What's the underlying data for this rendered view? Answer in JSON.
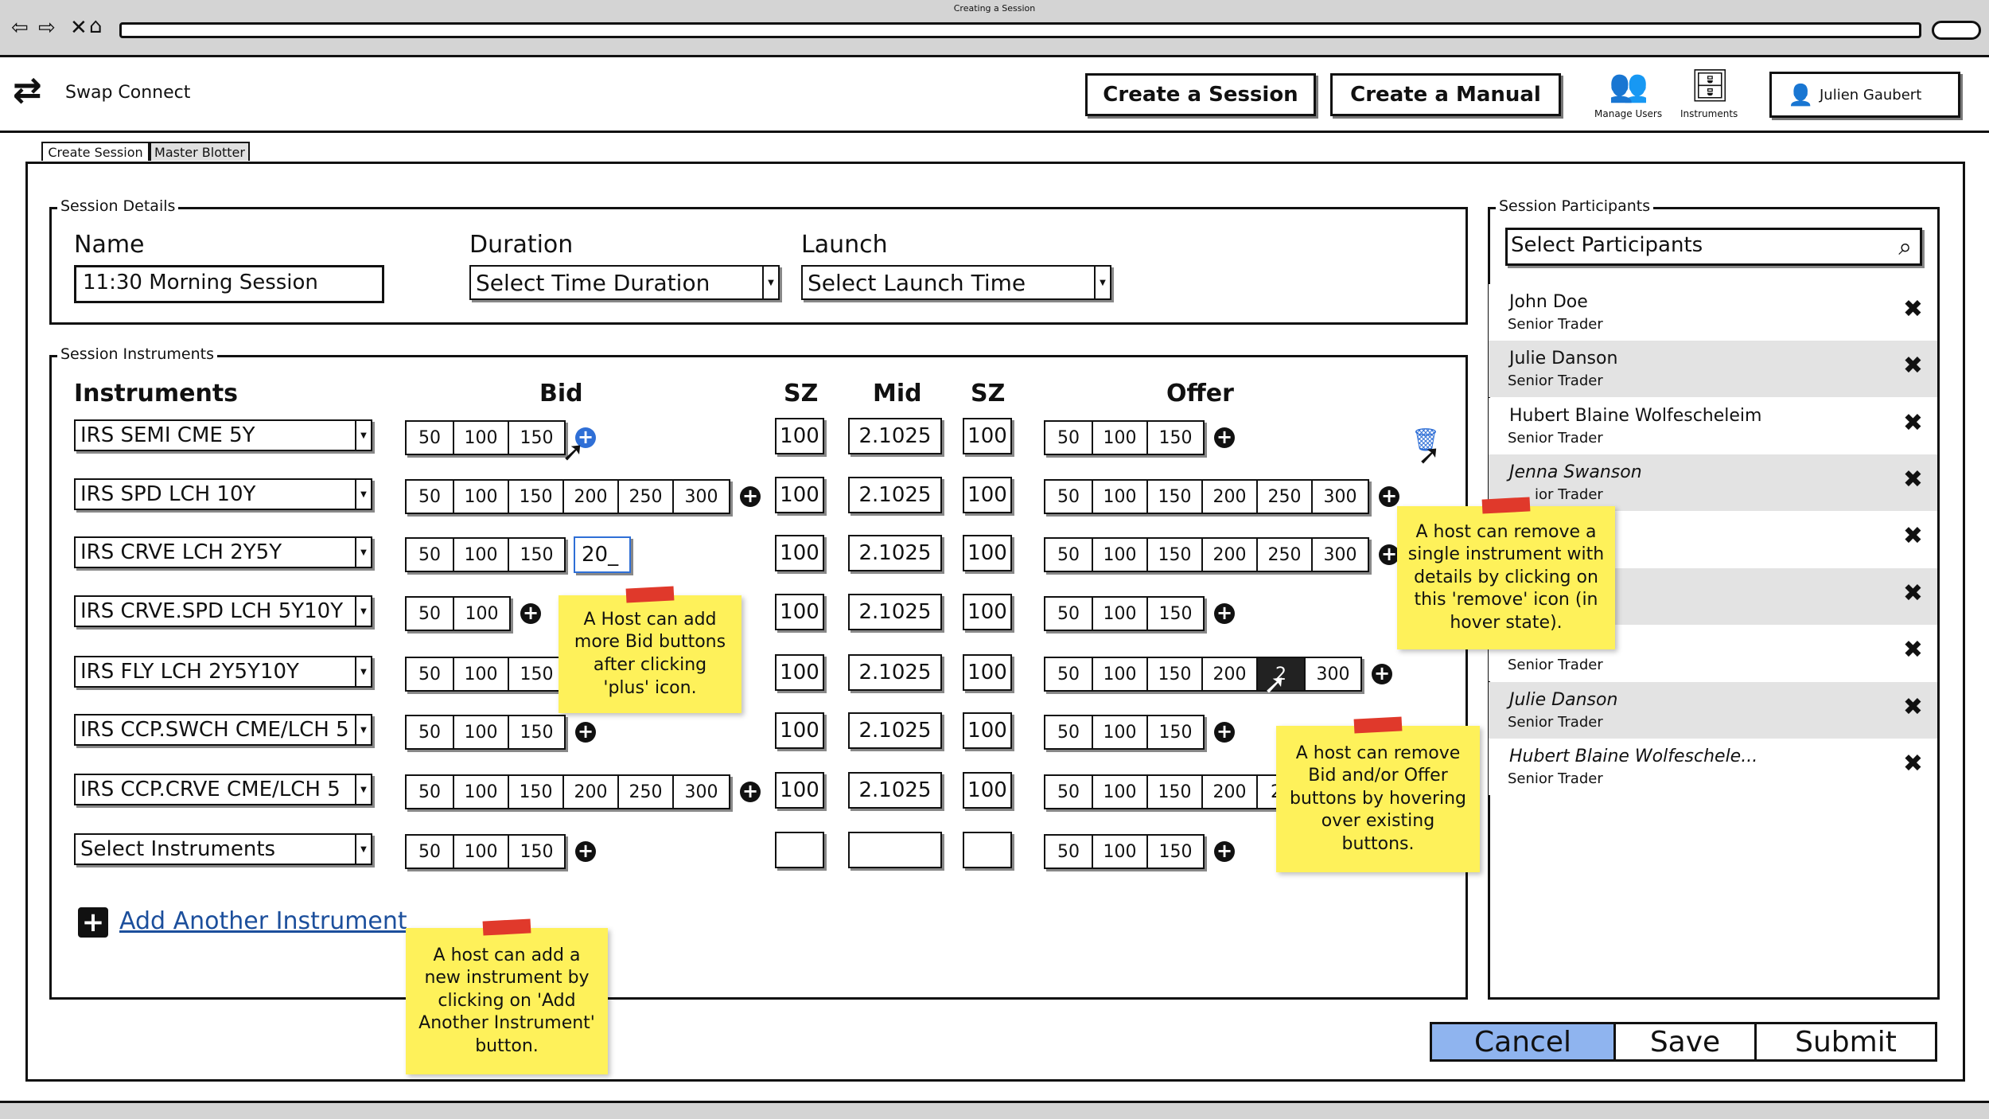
{
  "window": {
    "title": "Creating a Session"
  },
  "header": {
    "app_name": "Swap Connect",
    "create_session": "Create a Session",
    "create_manual": "Create a Manual",
    "manage_users": "Manage Users",
    "instruments": "Instruments",
    "user": "Julien Gaubert"
  },
  "tabs": [
    "Create Session",
    "Master Blotter"
  ],
  "details": {
    "title": "Session Details",
    "name_label": "Name",
    "name_value": "11:30 Morning Session",
    "duration_label": "Duration",
    "duration_value": "Select Time Duration",
    "launch_label": "Launch",
    "launch_value": "Select Launch Time"
  },
  "instruments": {
    "title": "Session Instruments",
    "headers": {
      "instruments": "Instruments",
      "bid": "Bid",
      "sz": "SZ",
      "mid": "Mid",
      "sz2": "SZ",
      "offer": "Offer"
    },
    "rows": [
      {
        "name": "IRS SEMI CME 5Y",
        "bid": [
          "50",
          "100",
          "150"
        ],
        "sz1": "100",
        "mid": "2.1025",
        "sz2": "100",
        "offer": [
          "50",
          "100",
          "150"
        ]
      },
      {
        "name": "IRS SPD LCH 10Y",
        "bid": [
          "50",
          "100",
          "150",
          "200",
          "250",
          "300"
        ],
        "sz1": "100",
        "mid": "2.1025",
        "sz2": "100",
        "offer": [
          "50",
          "100",
          "150",
          "200",
          "250",
          "300"
        ]
      },
      {
        "name": "IRS CRVE LCH 2Y5Y",
        "bid": [
          "50",
          "100",
          "150"
        ],
        "bid_edit": "20_",
        "sz1": "100",
        "mid": "2.1025",
        "sz2": "100",
        "offer": [
          "50",
          "100",
          "150",
          "200",
          "250",
          "300"
        ]
      },
      {
        "name": "IRS CRVE.SPD LCH 5Y10Y",
        "bid": [
          "50",
          "100"
        ],
        "sz1": "100",
        "mid": "2.1025",
        "sz2": "100",
        "offer": [
          "50",
          "100",
          "150"
        ]
      },
      {
        "name": "IRS FLY LCH 2Y5Y10Y",
        "bid": [
          "50",
          "100",
          "150"
        ],
        "sz1": "100",
        "mid": "2.1025",
        "sz2": "100",
        "offer": [
          "50",
          "100",
          "150",
          "200",
          "2",
          "300"
        ]
      },
      {
        "name": "IRS CCP.SWCH CME/LCH 5",
        "bid": [
          "50",
          "100",
          "150"
        ],
        "sz1": "100",
        "mid": "2.1025",
        "sz2": "100",
        "offer": [
          "50",
          "100",
          "150"
        ]
      },
      {
        "name": "IRS CCP.CRVE CME/LCH 5",
        "bid": [
          "50",
          "100",
          "150",
          "200",
          "250",
          "300"
        ],
        "sz1": "100",
        "mid": "2.1025",
        "sz2": "100",
        "offer": [
          "50",
          "100",
          "150",
          "200",
          "25"
        ]
      },
      {
        "name": "Select Instruments",
        "bid": [
          "50",
          "100",
          "150"
        ],
        "sz1": "",
        "mid": "",
        "sz2": "",
        "offer": [
          "50",
          "100",
          "150"
        ]
      }
    ],
    "add_another": "Add Another Instrument"
  },
  "participants": {
    "title": "Session Participants",
    "search_placeholder": "Select Participants",
    "list": [
      {
        "name": "John Doe",
        "role": "Senior Trader"
      },
      {
        "name": "Julie Danson",
        "role": "Senior Trader"
      },
      {
        "name": "Hubert Blaine Wolfescheleim",
        "role": "Senior Trader"
      },
      {
        "name": "Jenna Swanson",
        "role": "ior Trader"
      },
      {
        "name": "",
        "role": ""
      },
      {
        "name": "",
        "role": ""
      },
      {
        "name": "",
        "role": "Senior Trader"
      },
      {
        "name": "Julie Danson",
        "role": "Senior Trader"
      },
      {
        "name": "Hubert Blaine Wolfeschele...",
        "role": "Senior Trader"
      }
    ]
  },
  "notes": {
    "bid_add": "A Host can add more Bid buttons after clicking 'plus' icon.",
    "remove_instrument": "A host can remove a single instrument with details by clicking on this 'remove' icon (in hover state).",
    "remove_buttons": "A host can remove Bid and/or Offer buttons by hovering over existing buttons.",
    "add_instrument": "A host can add a new instrument by clicking on 'Add Another Instrument' button."
  },
  "footer": {
    "cancel": "Cancel",
    "save": "Save",
    "submit": "Submit"
  },
  "colors": {
    "note": "#fef15a",
    "tape": "#e0392b",
    "accent": "#8fb4ef",
    "link": "#1c4f9c"
  }
}
